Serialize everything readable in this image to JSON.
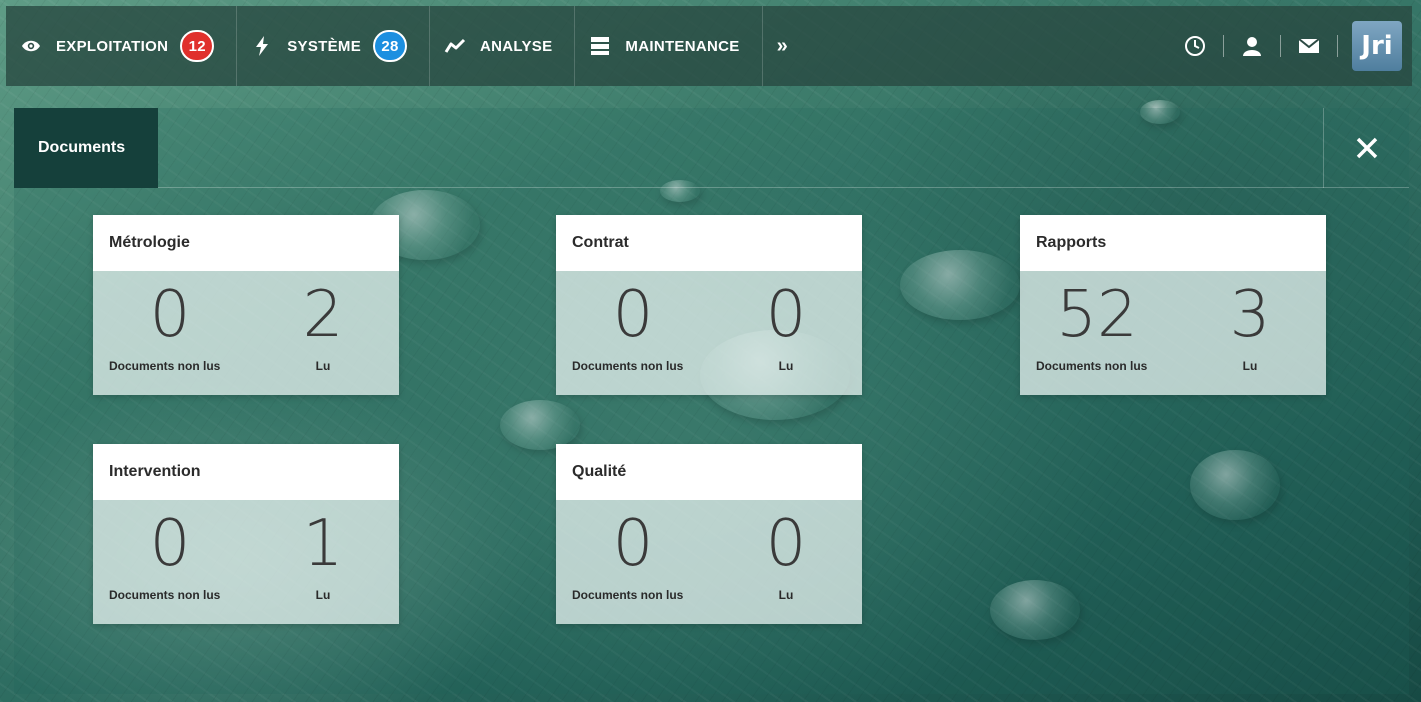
{
  "nav": {
    "items": [
      {
        "label": "EXPLOITATION",
        "icon": "eye-icon",
        "badge": "12",
        "badge_color": "#e0302c"
      },
      {
        "label": "SYSTÈME",
        "icon": "lightning-icon",
        "badge": "28",
        "badge_color": "#1c8fe0"
      },
      {
        "label": "ANALYSE",
        "icon": "trend-icon"
      },
      {
        "label": "MAINTENANCE",
        "icon": "server-icon"
      }
    ],
    "more": "»",
    "tools": [
      "clock-icon",
      "user-icon",
      "mail-icon"
    ],
    "logo": "Jri"
  },
  "panel": {
    "tab": "Documents",
    "close": "✕"
  },
  "cards": [
    {
      "title": "Métrologie",
      "unread": "0",
      "unread_label": "Documents non lus",
      "read": "2",
      "read_label": "Lu"
    },
    {
      "title": "Contrat",
      "unread": "0",
      "unread_label": "Documents non lus",
      "read": "0",
      "read_label": "Lu"
    },
    {
      "title": "Rapports",
      "unread": "52",
      "unread_label": "Documents non lus",
      "read": "3",
      "read_label": "Lu"
    },
    {
      "title": "Intervention",
      "unread": "0",
      "unread_label": "Documents non lus",
      "read": "1",
      "read_label": "Lu"
    },
    {
      "title": "Qualité",
      "unread": "0",
      "unread_label": "Documents non lus",
      "read": "0",
      "read_label": "Lu"
    }
  ]
}
